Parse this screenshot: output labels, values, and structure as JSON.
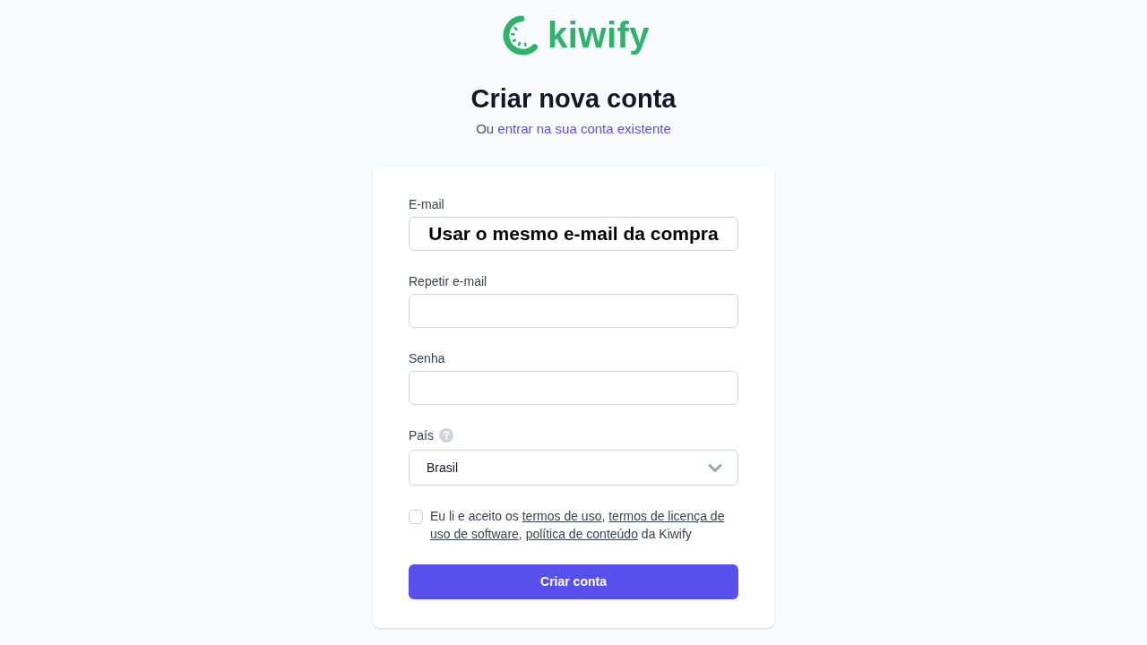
{
  "logo": {
    "text": "kiwify"
  },
  "heading": "Criar nova conta",
  "subheading": {
    "prefix": "Ou",
    "link": "entrar na sua conta existente"
  },
  "form": {
    "fields": [
      {
        "kind": "input",
        "label": "E-mail",
        "value": "Usar o mesmo e-mail da compra"
      },
      {
        "kind": "input",
        "label": "Repetir e-mail"
      },
      {
        "kind": "input",
        "label": "Senha"
      },
      {
        "kind": "select",
        "label": "País",
        "help": true,
        "value": "Brasil"
      }
    ],
    "terms": {
      "checked": false,
      "parts": [
        {
          "kind": "text",
          "text": "Eu li e aceito os "
        },
        {
          "kind": "link",
          "text": "termos de uso"
        },
        {
          "kind": "text",
          "text": ", "
        },
        {
          "kind": "link",
          "text": "termos de licença de"
        },
        {
          "kind": "link",
          "text": "uso de software"
        },
        {
          "kind": "text",
          "text": ", "
        },
        {
          "kind": "link",
          "text": "política de conteúdo"
        },
        {
          "kind": "text",
          "text": " da Kiwify"
        }
      ]
    },
    "submit_button": "Criar conta"
  }
}
